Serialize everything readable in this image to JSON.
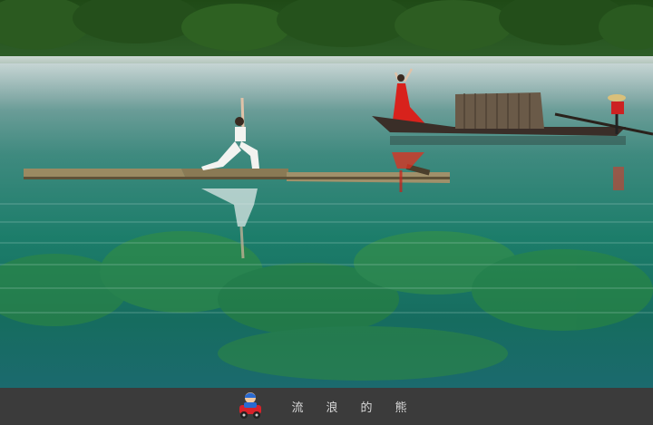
{
  "photo": {
    "subject": "misty-river-scene"
  },
  "watermark": {
    "chars": [
      "流",
      "浪",
      "的",
      "熊"
    ],
    "logo_icon": "cartoon-character-car-icon"
  },
  "colors": {
    "water_top": "#5a8c8c",
    "water_mid": "#1f7a6a",
    "water_deep": "#0e5e58",
    "treeline": "#1e4a1a",
    "dress_red": "#d8221c",
    "raft": "#8a7a55",
    "boat": "#3a2e28",
    "footer_bg": "#3b3b3b"
  }
}
